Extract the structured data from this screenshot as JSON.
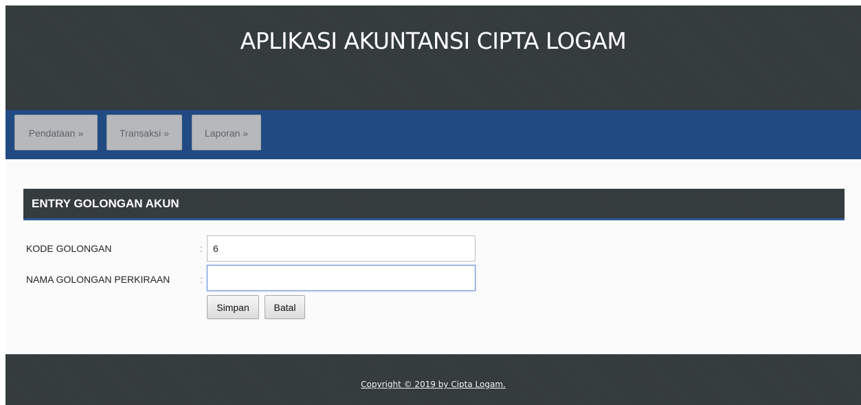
{
  "header": {
    "title": "APLIKASI AKUNTANSI CIPTA LOGAM"
  },
  "nav": {
    "items": [
      {
        "label": "Pendataan",
        "arrow": "»"
      },
      {
        "label": "Transaksi",
        "arrow": "»"
      },
      {
        "label": "Laporan",
        "arrow": "»"
      }
    ]
  },
  "section": {
    "title": "ENTRY GOLONGAN AKUN"
  },
  "form": {
    "kode_label": "KODE GOLONGAN",
    "kode_colon": ":",
    "kode_value": "6",
    "nama_label": "NAMA GOLONGAN PERKIRAAN",
    "nama_colon": ":",
    "nama_value": "",
    "save_label": "Simpan",
    "cancel_label": "Batal"
  },
  "footer": {
    "copyright": "Copyright © 2019 by Cipta Logam."
  },
  "colors": {
    "header_bg": "#343b3d",
    "nav_bg": "#214a82",
    "nav_button": "#b6b8bb",
    "accent_border": "#2c5a96"
  }
}
